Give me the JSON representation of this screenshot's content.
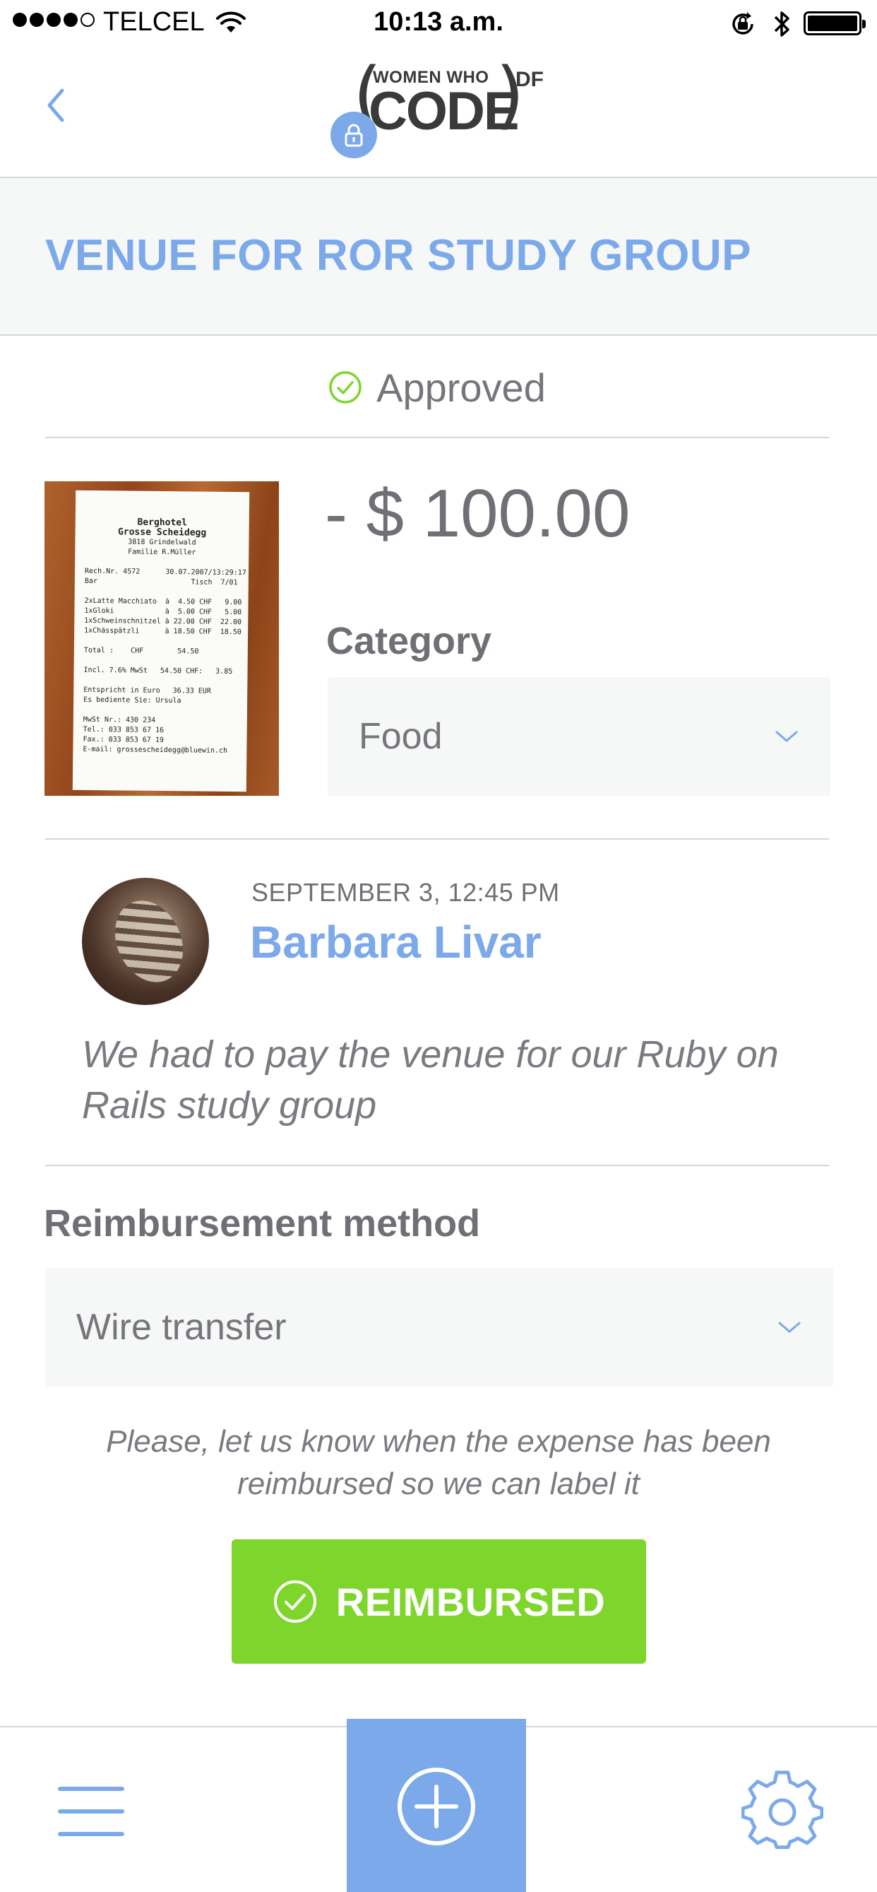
{
  "status_bar": {
    "carrier": "TELCEL",
    "time": "10:13 a.m."
  },
  "header": {
    "logo": {
      "women_who": "WOMEN WHO",
      "code": "CODE",
      "suffix": "DF"
    },
    "icons": [
      "back-chevron-icon",
      "lock-icon"
    ]
  },
  "expense": {
    "title": "VENUE FOR ROR STUDY GROUP",
    "status": "Approved",
    "amount": "- $ 100.00",
    "category_label": "Category",
    "category_value": "Food",
    "receipt_lines": [
      "Berghotel",
      "Grosse Scheidegg",
      "3818 Grindelwald",
      "Familie R.Müller",
      "",
      "Rech.Nr. 4572      30.07.2007/13:29:17",
      "Bar                      Tisch  7/01",
      "",
      "2xLatte Macchiato  à  4.50 CHF   9.00",
      "1xGloki            à  5.00 CHF   5.00",
      "1xSchweinschnitzel à 22.00 CHF  22.00",
      "1xChässpätzli      à 18.50 CHF  18.50",
      "",
      "Total :    CHF        54.50",
      "",
      "Incl. 7.6% MwSt   54.50 CHF:   3.85",
      "",
      "Entspricht in Euro   36.33 EUR",
      "Es bediente Sie: Ursula",
      "",
      "MwSt Nr.: 430 234",
      "Tel.: 033 853 67 16",
      "Fax.: 033 853 67 19",
      "E-mail: grossescheidegg@bluewin.ch"
    ]
  },
  "submission": {
    "date": "SEPTEMBER 3, 12:45 PM",
    "name": "Barbara Livar",
    "description": "We had to pay the venue for our Ruby on Rails study group"
  },
  "reimbursement": {
    "label": "Reimbursement method",
    "method": "Wire transfer",
    "note": "Please, let us know when the expense has been reimbursed so we can label it",
    "button_label": "REIMBURSED"
  },
  "tab_bar": {
    "icons": [
      "menu-icon",
      "plus-circle-icon",
      "gear-icon"
    ]
  },
  "colors": {
    "accent": "#7ca9ea",
    "success": "#7ed62c",
    "text": "#6f6f75",
    "panel": "#f6f7f7",
    "divider": "#d6d6d8"
  }
}
